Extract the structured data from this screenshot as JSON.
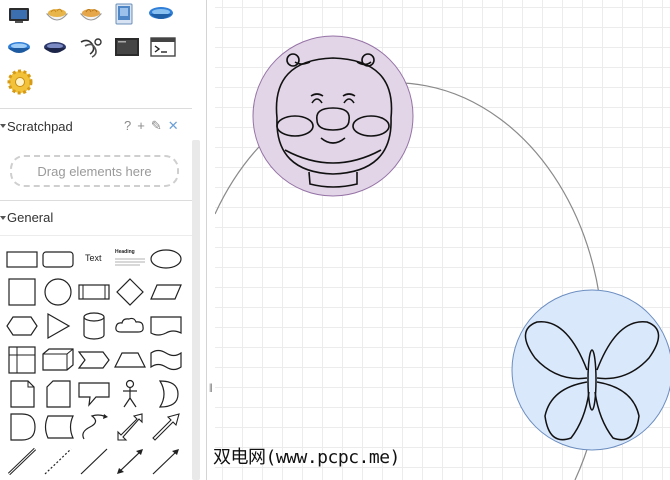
{
  "scratchpad": {
    "title": "Scratchpad",
    "actions": {
      "help": "?",
      "add": "+",
      "edit": "✎",
      "close": "✕"
    },
    "drop_hint": "Drag elements here"
  },
  "general": {
    "title": "General",
    "text_shape_label": "Text",
    "heading_shape_label": "Heading"
  },
  "library_icons": [
    "monitor-icon",
    "noodle-bowl-icon",
    "noodle-bowl-2-icon",
    "tablet-icon",
    "blue-bowl-icon",
    "blue-bowl-2-icon",
    "dark-bowl-icon",
    "chain-link-icon",
    "terminal-icon",
    "console-window-icon",
    "gear-icon"
  ],
  "canvas": {
    "ladybug_fill": "#e1d5e7",
    "ladybug_stroke": "#9673a6",
    "butterfly_fill": "#dae8fc",
    "butterfly_stroke": "#6c8ebf"
  },
  "watermark": "双电网(www.pcpc.me)"
}
